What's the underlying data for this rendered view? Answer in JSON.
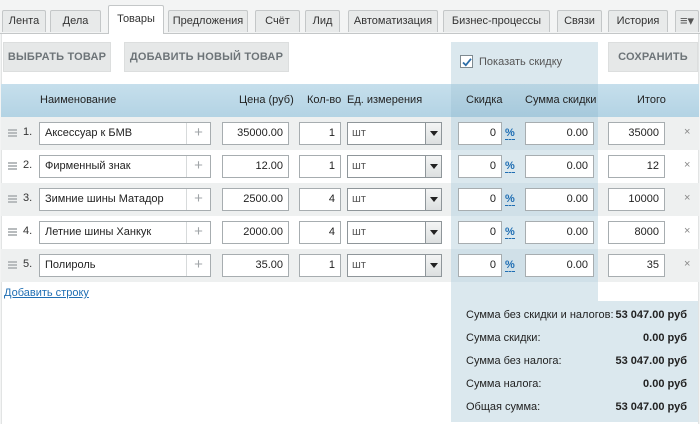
{
  "tabs": [
    {
      "label": "Лента"
    },
    {
      "label": "Дела"
    },
    {
      "label": "Товары",
      "active": true
    },
    {
      "label": "Предложения"
    },
    {
      "label": "Счёт"
    },
    {
      "label": "Лид"
    },
    {
      "label": "Автоматизация"
    },
    {
      "label": "Бизнес-процессы"
    },
    {
      "label": "Связи"
    },
    {
      "label": "История"
    }
  ],
  "toolbar": {
    "select_product": "ВЫБРАТЬ ТОВАР",
    "add_new_product": "ДОБАВИТЬ НОВЫЙ ТОВАР",
    "show_discount_label": "Показать скидку",
    "show_discount_checked": true,
    "save": "СОХРАНИТЬ"
  },
  "columns": {
    "name": "Наименование",
    "price": "Цена (руб)",
    "qty": "Кол-во",
    "unit": "Ед. измерения",
    "discount": "Скидка",
    "discount_sum": "Сумма скидки",
    "total": "Итого"
  },
  "rows": [
    {
      "num": "1.",
      "name": "Аксессуар к БМВ",
      "price": "35000.00",
      "qty": "1",
      "unit": "шт",
      "discount": "0",
      "discount_unit": "%",
      "discount_sum": "0.00",
      "total": "35000"
    },
    {
      "num": "2.",
      "name": "Фирменный знак",
      "price": "12.00",
      "qty": "1",
      "unit": "шт",
      "discount": "0",
      "discount_unit": "%",
      "discount_sum": "0.00",
      "total": "12"
    },
    {
      "num": "3.",
      "name": "Зимние шины Матадор",
      "price": "2500.00",
      "qty": "4",
      "unit": "шт",
      "discount": "0",
      "discount_unit": "%",
      "discount_sum": "0.00",
      "total": "10000"
    },
    {
      "num": "4.",
      "name": "Летние шины Ханкук",
      "price": "2000.00",
      "qty": "4",
      "unit": "шт",
      "discount": "0",
      "discount_unit": "%",
      "discount_sum": "0.00",
      "total": "8000"
    },
    {
      "num": "5.",
      "name": "Полироль",
      "price": "35.00",
      "qty": "1",
      "unit": "шт",
      "discount": "0",
      "discount_unit": "%",
      "discount_sum": "0.00",
      "total": "35"
    }
  ],
  "row_delete_glyph": "×",
  "add_row": "Добавить строку",
  "summary": {
    "no_discount_no_tax_label": "Сумма без скидки и налогов:",
    "no_discount_no_tax_value": "53 047.00 руб",
    "discount_label": "Сумма скидки:",
    "discount_value": "0.00 руб",
    "no_tax_label": "Сумма без налога:",
    "no_tax_value": "53 047.00 руб",
    "tax_label": "Сумма налога:",
    "tax_value": "0.00 руб",
    "total_label": "Общая сумма:",
    "total_value": "53 047.00 руб"
  },
  "icons": {
    "tab_menu": "menu-icon",
    "plus": "plus-icon",
    "dropdown": "chevron-down-icon",
    "drag": "drag-handle-icon",
    "delete": "close-icon"
  },
  "colors": {
    "header_bg": "#b9d5e3",
    "discount_column_bg": "#dbe8ee",
    "link": "#1f6eb3"
  }
}
